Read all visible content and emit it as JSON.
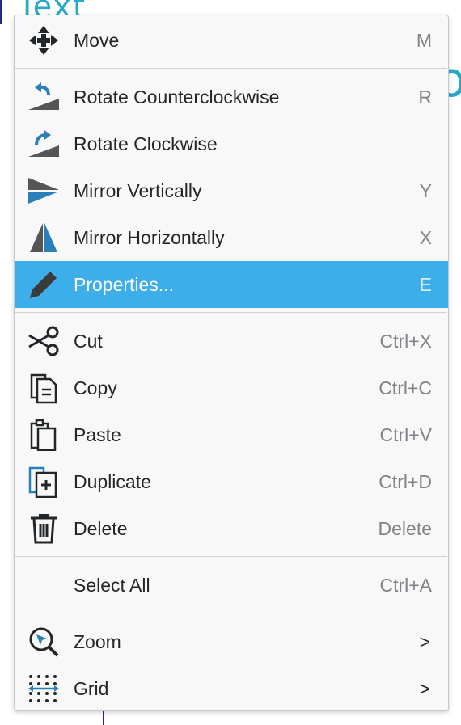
{
  "background": {
    "top_text": "Text",
    "right_text": "o"
  },
  "menu": {
    "items": [
      {
        "label": "Move",
        "shortcut": "M",
        "icon": "move-icon"
      },
      {
        "label": "Rotate Counterclockwise",
        "shortcut": "R",
        "icon": "rotate-ccw-icon"
      },
      {
        "label": "Rotate Clockwise",
        "shortcut": "",
        "icon": "rotate-cw-icon"
      },
      {
        "label": "Mirror Vertically",
        "shortcut": "Y",
        "icon": "mirror-vertical-icon"
      },
      {
        "label": "Mirror Horizontally",
        "shortcut": "X",
        "icon": "mirror-horizontal-icon"
      },
      {
        "label": "Properties...",
        "shortcut": "E",
        "icon": "pencil-icon",
        "highlighted": true
      },
      {
        "label": "Cut",
        "shortcut": "Ctrl+X",
        "icon": "scissors-icon"
      },
      {
        "label": "Copy",
        "shortcut": "Ctrl+C",
        "icon": "copy-icon"
      },
      {
        "label": "Paste",
        "shortcut": "Ctrl+V",
        "icon": "paste-icon"
      },
      {
        "label": "Duplicate",
        "shortcut": "Ctrl+D",
        "icon": "duplicate-icon"
      },
      {
        "label": "Delete",
        "shortcut": "Delete",
        "icon": "trash-icon"
      },
      {
        "label": "Select All",
        "shortcut": "Ctrl+A",
        "icon": ""
      },
      {
        "label": "Zoom",
        "submenu_arrow": ">",
        "icon": "zoom-icon"
      },
      {
        "label": "Grid",
        "submenu_arrow": ">",
        "icon": "grid-icon"
      }
    ]
  },
  "colors": {
    "highlight": "#3daee9",
    "text": "#232629",
    "shortcut": "#7f8286",
    "icon_blue": "#2980b9",
    "icon_dark": "#4d4d4d"
  }
}
